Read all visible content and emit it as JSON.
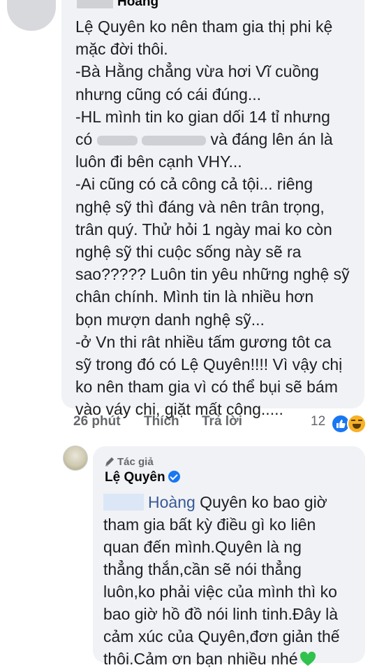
{
  "comment": {
    "author_suffix": "Hoàng",
    "lines": [
      "Lệ Quyên ko nên tham gia thị phi kệ",
      "mặc đời thôi.",
      "-Bà Hằng chẳng vừa hơi Vĩ cuồng",
      "nhưng cũng có cái đúng...",
      "-HL mình tin ko gian dối 14 tỉ nhưng",
      "và đáng lên án là",
      "luôn đi bên cạnh VHY...",
      "-Ai cũng có cả công cả tội... riêng",
      "nghệ sỹ thì đáng và nên trân trọng,",
      "trân quý. Thử hỏi 1 ngày mai ko còn",
      "nghệ sỹ thi cuộc sống này sẽ ra",
      "sao????? Luôn tin yêu những nghệ sỹ",
      "chân chính. Mình tin là nhiều hơn",
      "bọn mượn danh nghệ sỹ...",
      "-ở Vn thi rât nhiều tấm gương tôt ca",
      "sỹ trong đó có Lệ Quyên!!!! Vì vậy chị",
      "ko nên tham gia vì có thể bụi sẽ bám",
      "vào váy chị, giặt mất công....."
    ],
    "line5_prefix": "có",
    "time": "26 phút",
    "like_label": "Thích",
    "reply_label": "Trả lời",
    "reaction_count": "12"
  },
  "reply": {
    "badge": "Tác giả",
    "author": "Lệ Quyên",
    "mention": "Hoàng",
    "lines": [
      "Quyên ko bao giờ",
      "tham gia bất kỳ điều gì ko liên",
      "quan đến mình.Quyên là ng",
      "thẳng thắn,cần sẽ nói thẳng",
      "luôn,ko phải việc của mình thì ko",
      "bao giờ hồ đồ nói linh tinh.Đây là",
      "cảm xúc của Quyên,đơn giản thế",
      "thôi.Cảm ơn bạn nhiều nhé"
    ]
  },
  "colors": {
    "bubble": "#f0f2f5",
    "meta": "#65676b",
    "link": "#385898",
    "like": "#1877f2",
    "heart": "#31c24d"
  },
  "icons": [
    "pen-icon",
    "verified-icon",
    "like-reaction-icon",
    "haha-reaction-icon",
    "green-heart-icon"
  ]
}
